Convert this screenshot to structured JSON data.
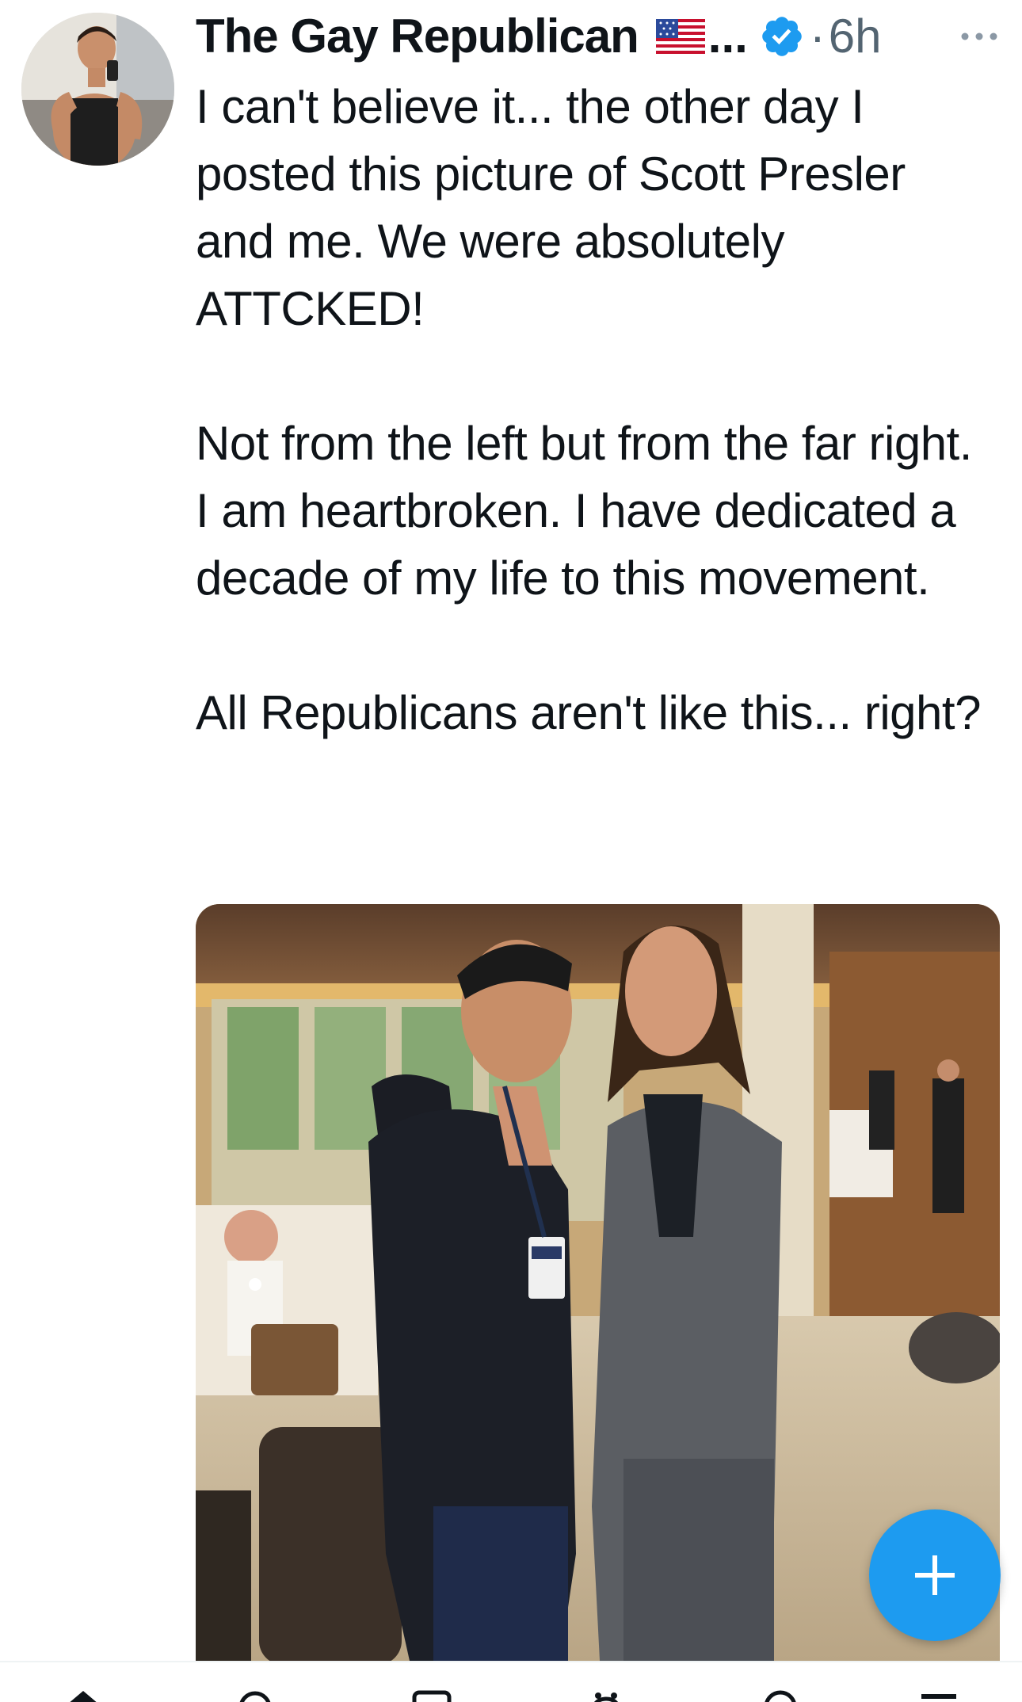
{
  "tweet": {
    "display_name": "The Gay Republican",
    "name_truncation": "...",
    "separator": "·",
    "timestamp": "6h",
    "body_paragraphs": [
      "I can't believe it... the other day I posted this picture of Scott Presler and me. We were absolutely ATTCKED!",
      "Not from the left but from the far right. I am heartbroken. I have dedicated a decade of my life to this movement.",
      "All Republicans aren't like this... right?"
    ],
    "icons": {
      "flag": "us-flag-icon",
      "verified": "verified-badge-icon",
      "more": "more-options-icon"
    }
  },
  "fab": {
    "icon": "plus-icon"
  },
  "bottom_nav": {
    "icons": [
      "home-icon",
      "search-icon",
      "communities-icon",
      "notifications-icon",
      "messages-icon"
    ]
  },
  "colors": {
    "accent": "#1d9bf0",
    "text": "#0f1419",
    "secondary_text": "#536471"
  }
}
